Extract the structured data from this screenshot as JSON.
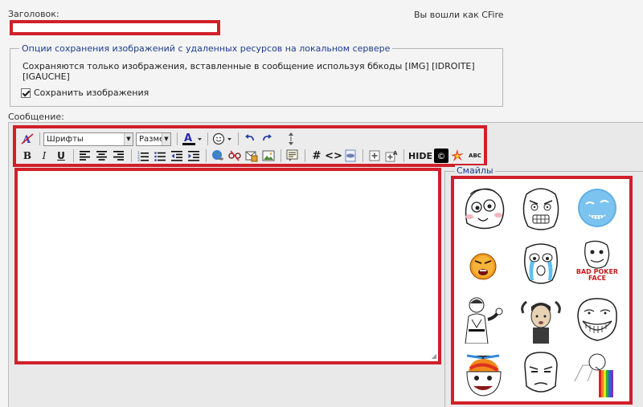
{
  "header": {
    "title_label": "Заголовок:",
    "title_value": "",
    "logged_in": "Вы вошли как CFire"
  },
  "options": {
    "legend": "Опции сохранения изображений с удаленных ресурсов на локальном сервере",
    "text": "Сохраняются только изображения, вставленные в сообщение используя ббкоды [IMG] [IDROITE] [IGAUCHE]",
    "save_label": "Сохранить изображения",
    "save_checked": true
  },
  "message": {
    "label": "Сообщение:",
    "value": ""
  },
  "toolbar": {
    "font_select": "Шрифты",
    "size_select": "Разме",
    "hide_label": "HIDE",
    "copyright_glyph": "©",
    "abc_label": "ABC"
  },
  "smilies": {
    "legend": "Смайлы",
    "items": [
      "derp-smiley",
      "fuuu-smiley",
      "forever-alone-smiley",
      "angry-orange-smiley",
      "crying-smiley",
      "bad-poker-face-smiley",
      "karate-smiley",
      "jackie-chan-smiley",
      "trollface-smiley",
      "propeller-cap-smiley",
      "are-you-serious-smiley",
      "rainbow-puke-smiley"
    ],
    "poker_face_caption": "BAD POKER FACE"
  },
  "colors": {
    "highlight": "#d0202a",
    "legend_text": "#1d3e8c"
  }
}
